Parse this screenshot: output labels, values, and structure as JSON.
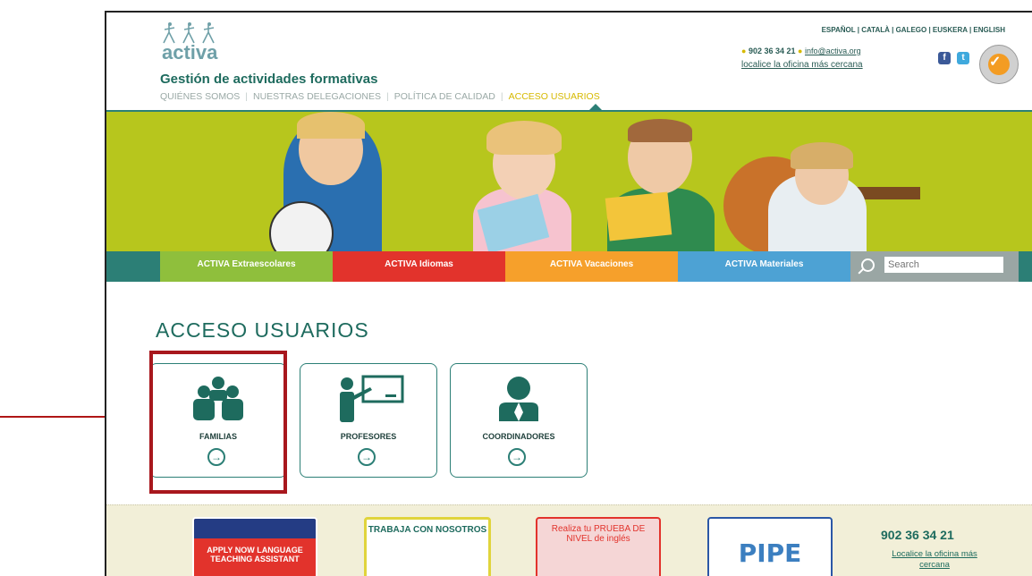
{
  "header": {
    "logo_text": "activa",
    "tagline": "Gestión de actividades formativas",
    "nav": [
      "QUIÉNES SOMOS",
      "NUESTRAS DELEGACIONES",
      "POLÍTICA DE CALIDAD",
      "ACCESO USUARIOS"
    ],
    "languages": "ESPAÑOL | CATALÀ | GALEGO | EUSKERA | ENGLISH",
    "phone": "902 36 34 21",
    "email": "info@activa.org",
    "locate_office": "localice la oficina más cercana",
    "social": [
      "f",
      "t"
    ]
  },
  "categories": [
    "ACTIVA Extraescolares",
    "ACTIVA Idiomas",
    "ACTIVA Vacaciones",
    "ACTIVA Materiales"
  ],
  "search": {
    "placeholder": "Search"
  },
  "section": {
    "title": "ACCESO USUARIOS"
  },
  "cards": [
    {
      "label": "FAMILIAS",
      "icon": "family-icon"
    },
    {
      "label": "PROFESORES",
      "icon": "teacher-icon"
    },
    {
      "label": "COORDINADORES",
      "icon": "coordinator-icon"
    }
  ],
  "promos": {
    "apply": "APPLY NOW LANGUAGE TEACHING ASSISTANT",
    "work": "TRABAJA CON NOSOTROS",
    "test": "Realiza tu PRUEBA DE NIVEL de inglés",
    "pipe": "PIPE"
  },
  "footer": {
    "phone": "902 36 34 21",
    "locate": "Localice la oficina más cercana"
  },
  "colors": {
    "brand_teal": "#2c7f76",
    "extraescolares": "#8fbf3c",
    "idiomas": "#e2332c",
    "vacaciones": "#f6a02b",
    "materiales": "#4da2d4",
    "highlight": "#a8171d"
  }
}
